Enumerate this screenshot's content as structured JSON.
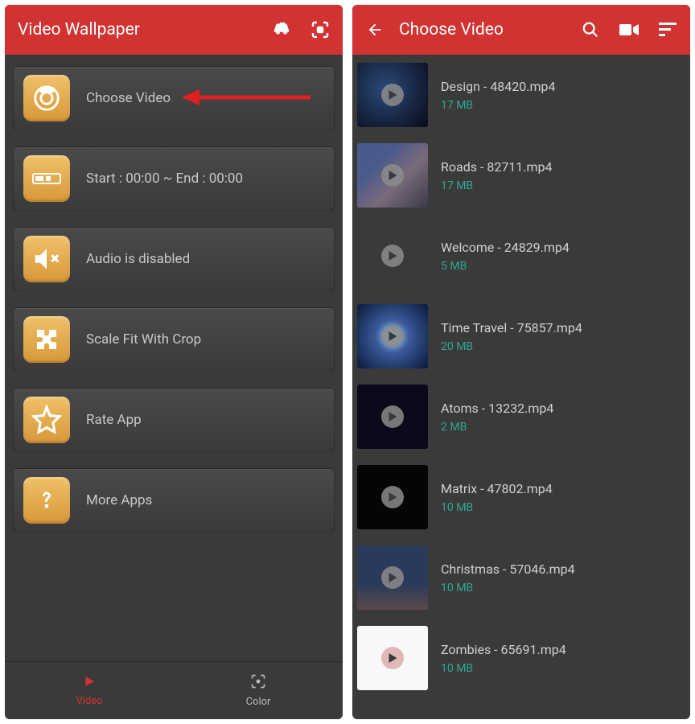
{
  "left": {
    "title": "Video Wallpaper",
    "menu": [
      {
        "label": "Choose Video",
        "icon": "camera"
      },
      {
        "label": "Start : 00:00 ~ End : 00:00",
        "icon": "timeline"
      },
      {
        "label": "Audio is disabled",
        "icon": "mute"
      },
      {
        "label": "Scale Fit With Crop",
        "icon": "puzzle"
      },
      {
        "label": "Rate App",
        "icon": "star"
      },
      {
        "label": "More Apps",
        "icon": "question"
      }
    ],
    "nav": {
      "video": "Video",
      "color": "Color"
    }
  },
  "right": {
    "title": "Choose Video",
    "videos": [
      {
        "name": "Design - 48420.mp4",
        "size": "17 MB"
      },
      {
        "name": "Roads - 82711.mp4",
        "size": "17 MB"
      },
      {
        "name": "Welcome - 24829.mp4",
        "size": "5 MB"
      },
      {
        "name": "Time Travel - 75857.mp4",
        "size": "20 MB"
      },
      {
        "name": "Atoms - 13232.mp4",
        "size": "2 MB"
      },
      {
        "name": "Matrix - 47802.mp4",
        "size": "10 MB"
      },
      {
        "name": "Christmas - 57046.mp4",
        "size": "10 MB"
      },
      {
        "name": "Zombies - 65691.mp4",
        "size": "10 MB"
      }
    ]
  }
}
